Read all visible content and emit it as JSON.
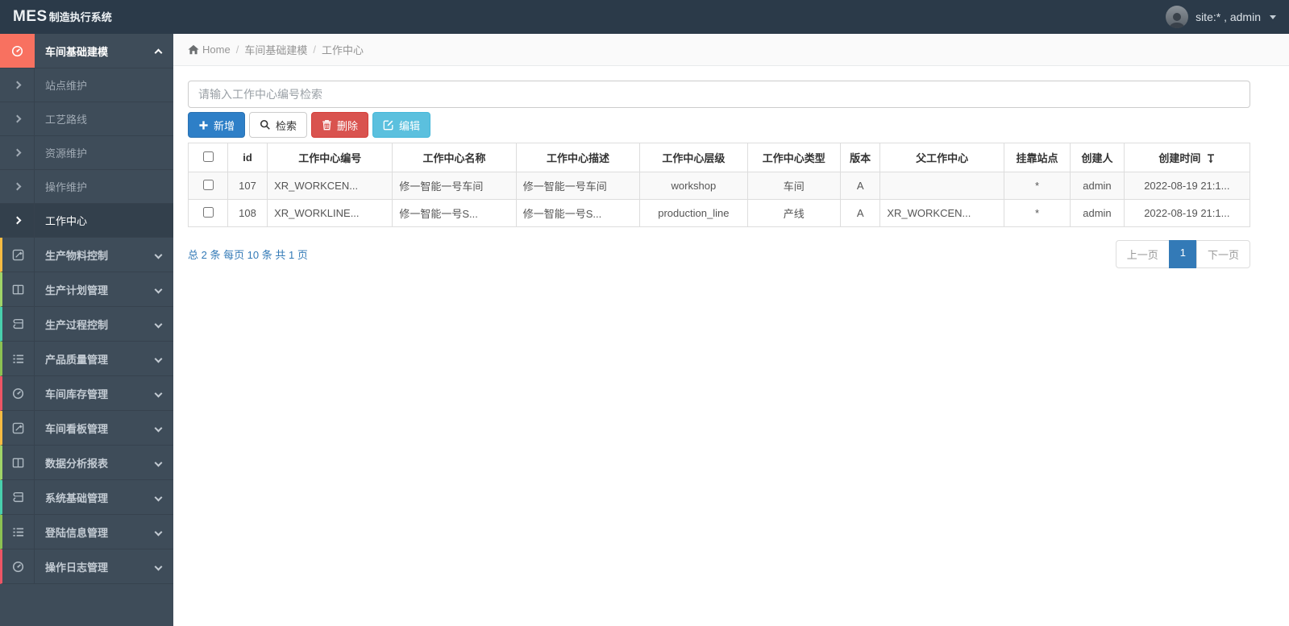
{
  "topbar": {
    "brand_bold": "MES",
    "brand_rest": "制造执行系统",
    "user_label": "site:* , admin"
  },
  "breadcrumb": {
    "separator": "/",
    "items": [
      "Home",
      "车间基础建模",
      "工作中心"
    ]
  },
  "sidebar": {
    "active_group": {
      "icon": "dashboard-icon",
      "accent": "#f87160",
      "label": "车间基础建模",
      "children": [
        {
          "label": "站点维护",
          "active": false
        },
        {
          "label": "工艺路线",
          "active": false
        },
        {
          "label": "资源维护",
          "active": false
        },
        {
          "label": "操作维护",
          "active": false
        },
        {
          "label": "工作中心",
          "active": true
        }
      ]
    },
    "groups": [
      {
        "label": "生产物料控制",
        "icon": "pencil-square-icon",
        "accent": "#f6bb42"
      },
      {
        "label": "生产计划管理",
        "icon": "columns-icon",
        "accent": "#a0d468"
      },
      {
        "label": "生产过程控制",
        "icon": "book-icon",
        "accent": "#48cfad"
      },
      {
        "label": "产品质量管理",
        "icon": "list-icon",
        "accent": "#8cc152"
      },
      {
        "label": "车间库存管理",
        "icon": "dashboard-icon",
        "accent": "#ed5565"
      },
      {
        "label": "车间看板管理",
        "icon": "pencil-square-icon",
        "accent": "#f6bb42"
      },
      {
        "label": "数据分析报表",
        "icon": "columns-icon",
        "accent": "#a0d468"
      },
      {
        "label": "系统基础管理",
        "icon": "book-icon",
        "accent": "#48cfad"
      },
      {
        "label": "登陆信息管理",
        "icon": "list-icon",
        "accent": "#8cc152"
      },
      {
        "label": "操作日志管理",
        "icon": "dashboard-icon",
        "accent": "#ed5565"
      }
    ]
  },
  "toolbar": {
    "search_placeholder": "请输入工作中心编号检索",
    "buttons": [
      {
        "label": "新增",
        "icon": "plus-icon",
        "style": "primary"
      },
      {
        "label": "检索",
        "icon": "search-icon",
        "style": "default"
      },
      {
        "label": "删除",
        "icon": "trash-icon",
        "style": "danger"
      },
      {
        "label": "编辑",
        "icon": "edit-icon",
        "style": "info"
      }
    ]
  },
  "table": {
    "columns": [
      "id",
      "工作中心编号",
      "工作中心名称",
      "工作中心描述",
      "工作中心层级",
      "工作中心类型",
      "版本",
      "父工作中心",
      "挂靠站点",
      "创建人",
      "创建时间"
    ],
    "left_aligned_columns": [
      1,
      2,
      3,
      7
    ],
    "rows": [
      [
        "107",
        "XR_WORKCEN...",
        "修一智能一号车间",
        "修一智能一号车间",
        "workshop",
        "车间",
        "A",
        "",
        "*",
        "admin",
        "2022-08-19 21:1..."
      ],
      [
        "108",
        "XR_WORKLINE...",
        "修一智能一号S...",
        "修一智能一号S...",
        "production_line",
        "产线",
        "A",
        "XR_WORKCEN...",
        "*",
        "admin",
        "2022-08-19 21:1..."
      ]
    ]
  },
  "pagination": {
    "summary": "总 2 条  每页 10 条  共 1 页",
    "prev_label": "上一页",
    "current_page": "1",
    "next_label": "下一页"
  },
  "colors": {
    "topbar": "#2b3a49",
    "sidebar": "#3e4c59",
    "accent_salmon": "#f87160",
    "primary_blue": "#2e7fc7",
    "danger_red": "#d9534f",
    "info_blue": "#5bc0de",
    "link_blue": "#337ab7",
    "accent_yellow": "#f6bb42",
    "accent_green": "#a0d468",
    "accent_teal": "#48cfad",
    "accent_olive": "#8cc152",
    "accent_red": "#ed5565"
  }
}
